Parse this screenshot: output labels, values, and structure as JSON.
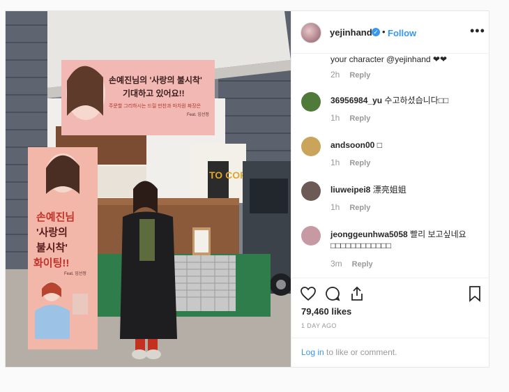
{
  "post": {
    "username": "yejinhand",
    "follow_label": "Follow",
    "dot": "•",
    "verified_glyph": "✓",
    "more_label": "•••"
  },
  "photo": {
    "banner_line1": "손예진님의 '사랑의 불시착'",
    "banner_line2": "기대하고 있어요!!",
    "banner_sub": "주문할 그리하시는 드릴 만찬과 마차원 짜장은",
    "banner_feat": "Feat. 임선정",
    "standee_line1": "손예진님",
    "standee_line2": "'사랑의",
    "standee_line3": "불시착'",
    "standee_line4": "화이팅!!",
    "standee_feat": "Feat. 임선정",
    "coffee_sign": "TO COFFEE"
  },
  "comments": [
    {
      "user": "",
      "text": "your character @yejinhand ❤❤",
      "time": "2h",
      "reply": "Reply",
      "avatar_color": ""
    },
    {
      "user": "36956984_yu",
      "text": "수고하셨습니다□□",
      "time": "1h",
      "reply": "Reply",
      "avatar_color": "#4f7a3a"
    },
    {
      "user": "andsoon00",
      "text": "□",
      "time": "1h",
      "reply": "Reply",
      "avatar_color": "#c9a45a"
    },
    {
      "user": "liuweipei8",
      "text": "漂亮姐姐",
      "time": "1h",
      "reply": "Reply",
      "avatar_color": "#6b5a55"
    },
    {
      "user": "jeonggeunhwa5058",
      "text": "빨리 보고싶네요",
      "text2": "□□□□□□□□□□□□",
      "time": "3m",
      "reply": "Reply",
      "avatar_color": "#c79aa3"
    }
  ],
  "actions": {
    "likes": "79,460 likes",
    "date": "1 DAY AGO"
  },
  "login": {
    "link": "Log in",
    "rest": " to like or comment."
  },
  "colors": {
    "accent": "#3897f0",
    "text": "#262626",
    "muted": "#999999"
  }
}
